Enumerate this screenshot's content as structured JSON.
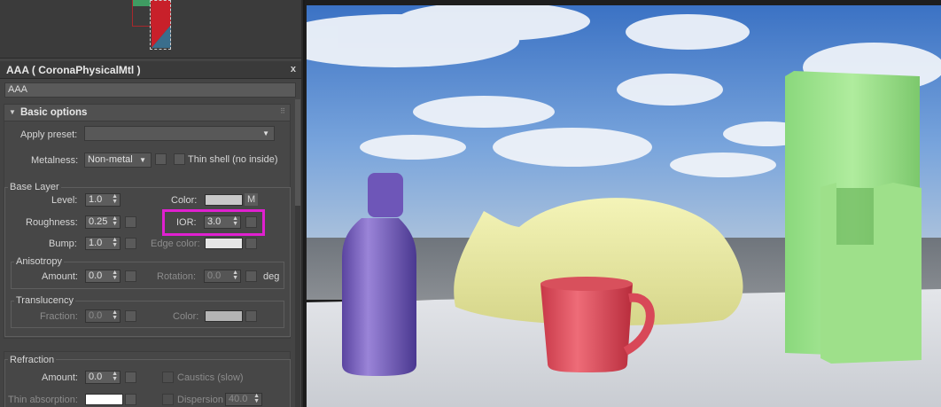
{
  "panel": {
    "title": "AAA  ( CoronaPhysicalMtl )",
    "close": "x",
    "material_name": "AAA"
  },
  "basic_options": {
    "header": "Basic options",
    "apply_preset_label": "Apply preset:",
    "apply_preset_value": "",
    "metalness_label": "Metalness:",
    "metalness_value": "Non-metal",
    "thin_shell_label": "Thin shell (no inside)"
  },
  "base_layer": {
    "title": "Base Layer",
    "level_label": "Level:",
    "level_value": "1.0",
    "color_label": "Color:",
    "color_map_btn": "M",
    "roughness_label": "Roughness:",
    "roughness_value": "0.25",
    "ior_label": "IOR:",
    "ior_value": "3.0",
    "bump_label": "Bump:",
    "bump_value": "1.0",
    "edge_color_label": "Edge color:"
  },
  "anisotropy": {
    "title": "Anisotropy",
    "amount_label": "Amount:",
    "amount_value": "0.0",
    "rotation_label": "Rotation:",
    "rotation_value": "0.0",
    "deg_label": "deg"
  },
  "translucency": {
    "title": "Translucency",
    "fraction_label": "Fraction:",
    "fraction_value": "0.0",
    "color_label": "Color:"
  },
  "refraction": {
    "title": "Refraction",
    "amount_label": "Amount:",
    "amount_value": "0.0",
    "caustics_label": "Caustics (slow)",
    "thin_absorption_label": "Thin absorption:",
    "dispersion_label": "Dispersion",
    "dispersion_value": "40.0"
  },
  "colors": {
    "highlight": "#e020d0",
    "base_color_swatch": "#c8c8c8",
    "edge_color_swatch": "#e6e6e6",
    "translucency_swatch": "#b4b4b4",
    "thin_absorption_swatch": "#ffffff"
  }
}
